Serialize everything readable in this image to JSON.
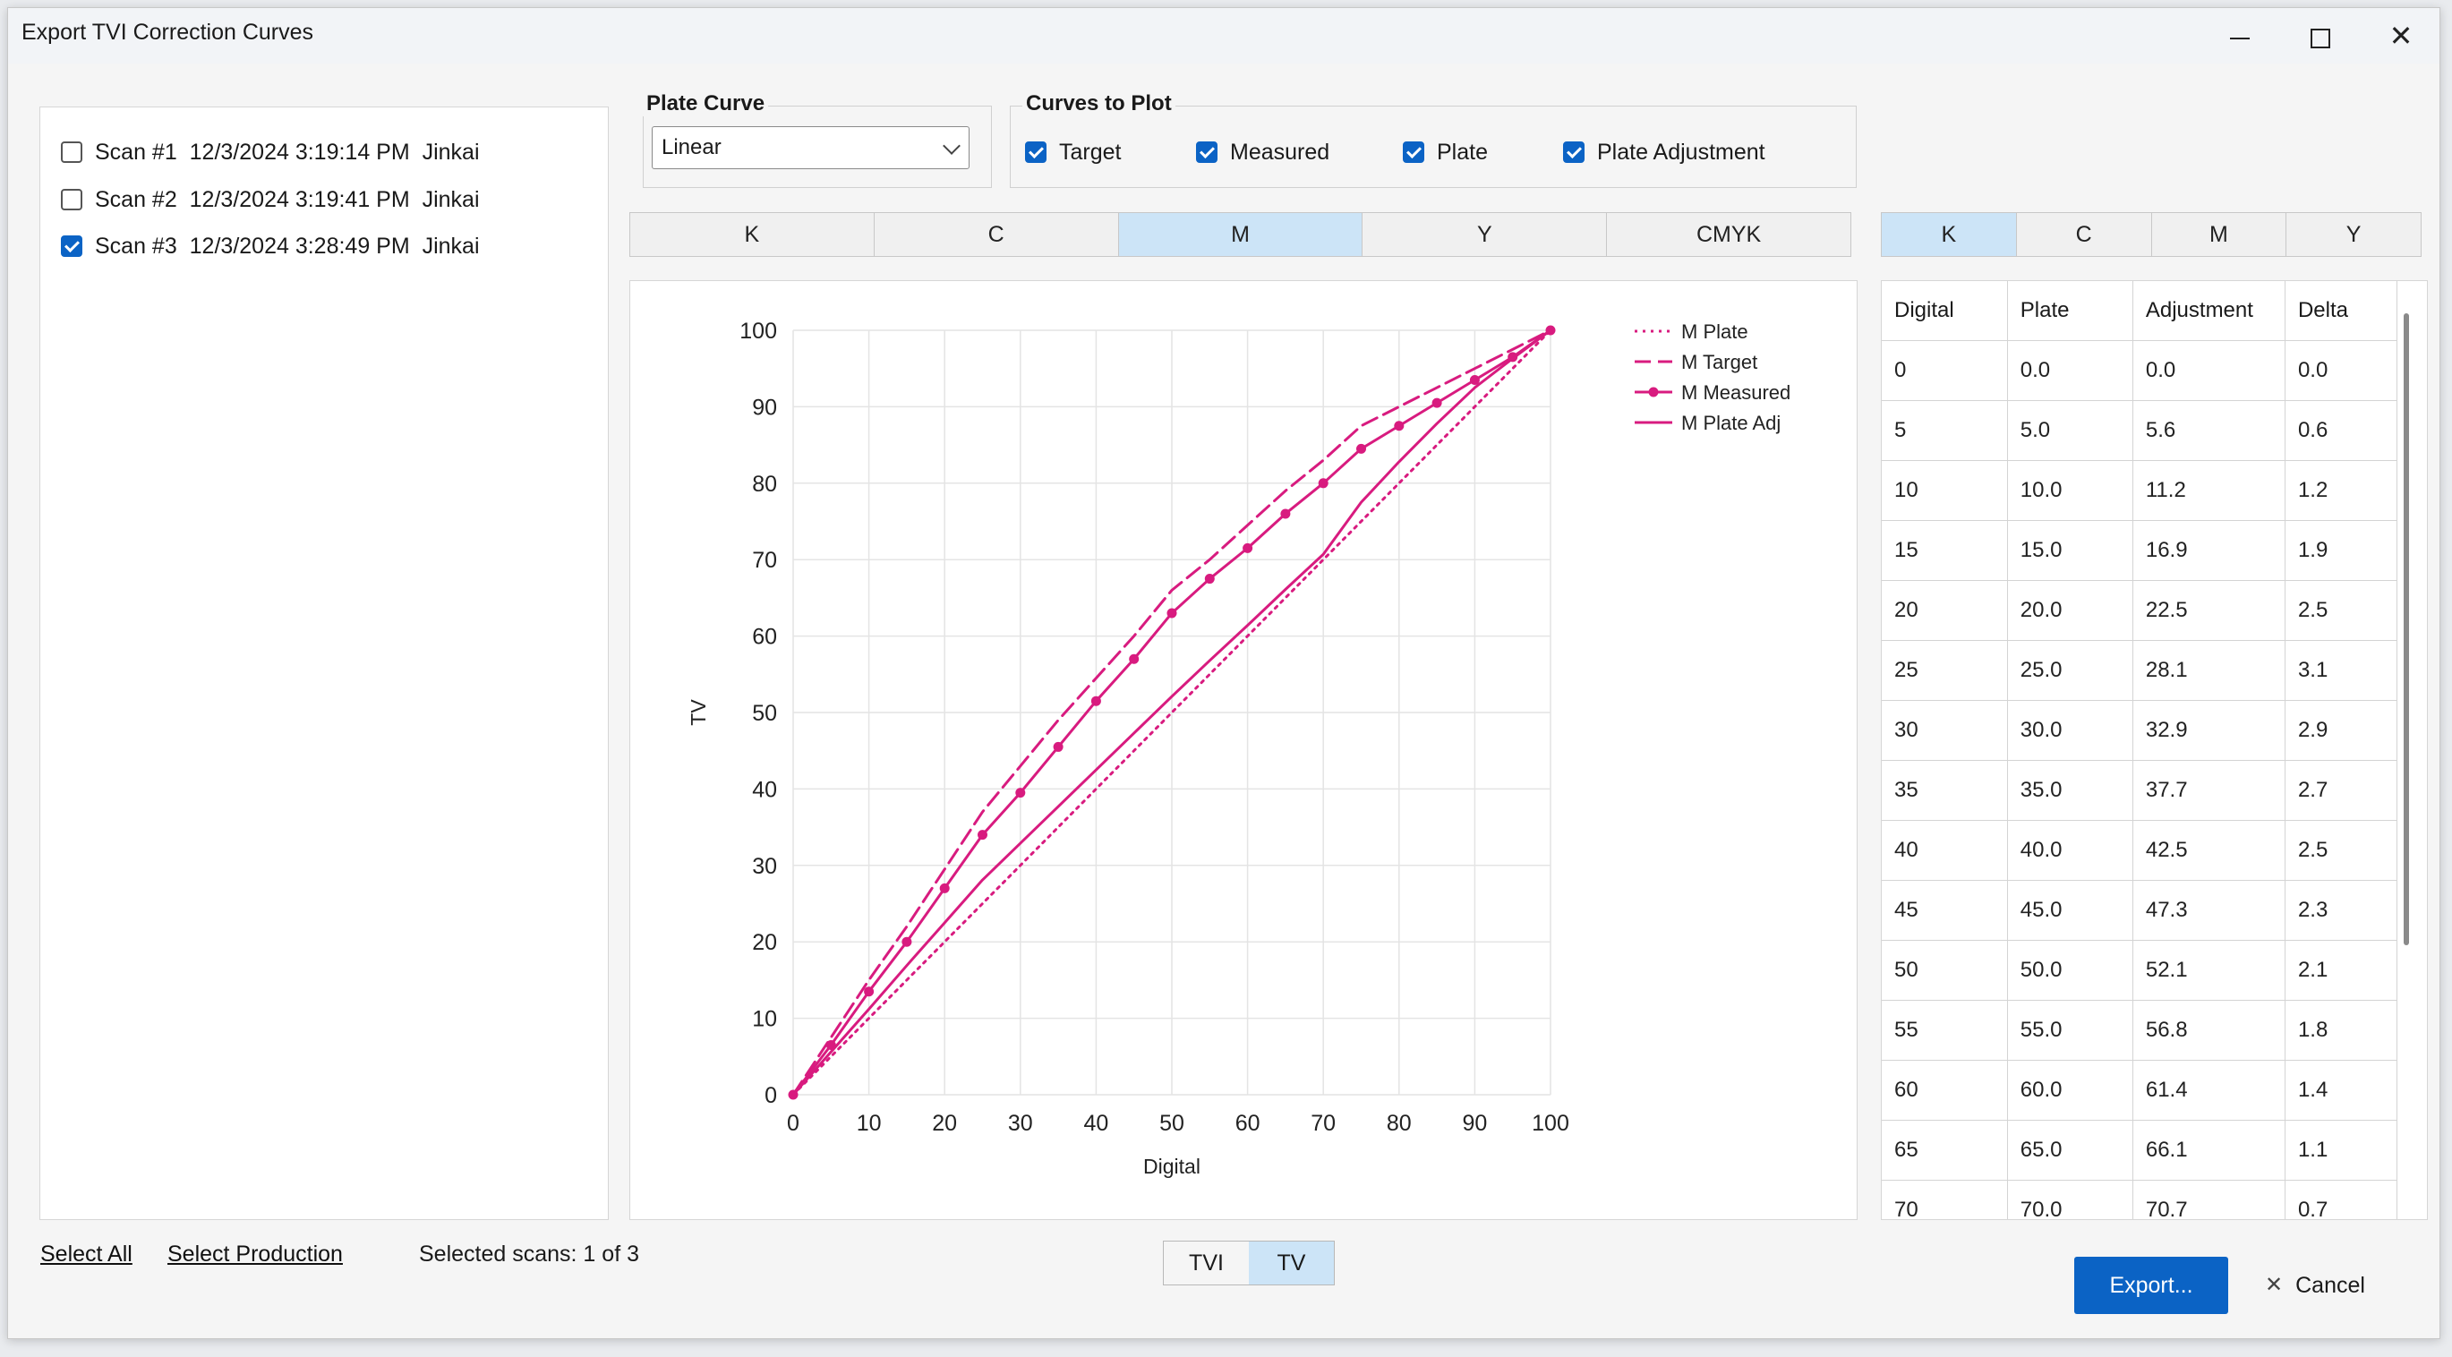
{
  "window": {
    "title": "Export TVI Correction Curves",
    "minimize_icon": "minimize-icon",
    "maximize_icon": "maximize-icon",
    "close_icon": "close-icon"
  },
  "scans": [
    {
      "label": "Scan #1",
      "date": "12/3/2024 3:19:14 PM",
      "user": "Jinkai",
      "checked": false
    },
    {
      "label": "Scan #2",
      "date": "12/3/2024 3:19:41 PM",
      "user": "Jinkai",
      "checked": false
    },
    {
      "label": "Scan #3",
      "date": "12/3/2024 3:28:49 PM",
      "user": "Jinkai",
      "checked": true
    }
  ],
  "plate_curve": {
    "label": "Plate Curve",
    "value": "Linear"
  },
  "curves_to_plot": {
    "label": "Curves to Plot",
    "items": [
      {
        "label": "Target",
        "checked": true
      },
      {
        "label": "Measured",
        "checked": true
      },
      {
        "label": "Plate",
        "checked": true
      },
      {
        "label": "Plate Adjustment",
        "checked": true
      }
    ]
  },
  "channel_tabs": [
    "K",
    "C",
    "M",
    "Y",
    "CMYK"
  ],
  "channel_selected": "M",
  "table_tabs": [
    "K",
    "C",
    "M",
    "Y"
  ],
  "table_selected": "K",
  "table": {
    "headers": [
      "Digital",
      "Plate",
      "Adjustment",
      "Delta"
    ],
    "rows": [
      [
        "0",
        "0.0",
        "0.0",
        "0.0"
      ],
      [
        "5",
        "5.0",
        "5.6",
        "0.6"
      ],
      [
        "10",
        "10.0",
        "11.2",
        "1.2"
      ],
      [
        "15",
        "15.0",
        "16.9",
        "1.9"
      ],
      [
        "20",
        "20.0",
        "22.5",
        "2.5"
      ],
      [
        "25",
        "25.0",
        "28.1",
        "3.1"
      ],
      [
        "30",
        "30.0",
        "32.9",
        "2.9"
      ],
      [
        "35",
        "35.0",
        "37.7",
        "2.7"
      ],
      [
        "40",
        "40.0",
        "42.5",
        "2.5"
      ],
      [
        "45",
        "45.0",
        "47.3",
        "2.3"
      ],
      [
        "50",
        "50.0",
        "52.1",
        "2.1"
      ],
      [
        "55",
        "55.0",
        "56.8",
        "1.8"
      ],
      [
        "60",
        "60.0",
        "61.4",
        "1.4"
      ],
      [
        "65",
        "65.0",
        "66.1",
        "1.1"
      ],
      [
        "70",
        "70.0",
        "70.7",
        "0.7"
      ]
    ]
  },
  "footer": {
    "select_all": "Select All",
    "select_production": "Select Production",
    "selected_scans": "Selected scans: 1 of 3",
    "mode_options": [
      "TVI",
      "TV"
    ],
    "mode_selected": "TV",
    "export_label": "Export...",
    "cancel_label": "Cancel"
  },
  "chart_data": {
    "type": "line",
    "xlabel": "Digital",
    "ylabel": "TV",
    "xlim": [
      0,
      100
    ],
    "ylim": [
      0,
      100
    ],
    "xticks": [
      0,
      10,
      20,
      30,
      40,
      50,
      60,
      70,
      80,
      90,
      100
    ],
    "yticks": [
      0,
      10,
      20,
      30,
      40,
      50,
      60,
      70,
      80,
      90,
      100
    ],
    "grid": true,
    "legend_position": "top-right",
    "color": "#d81b7f",
    "series": [
      {
        "name": "M Plate",
        "style": "dotted",
        "x": [
          0,
          100
        ],
        "y": [
          0,
          100
        ]
      },
      {
        "name": "M Target",
        "style": "dashed",
        "x": [
          0,
          5,
          10,
          15,
          20,
          25,
          30,
          35,
          40,
          45,
          50,
          55,
          60,
          65,
          70,
          75,
          80,
          85,
          90,
          95,
          100
        ],
        "y": [
          0,
          7.5,
          15,
          22,
          29.5,
          37,
          43,
          49,
          54.5,
          60,
          66,
          70,
          74.5,
          79,
          83,
          87.5,
          90,
          92.5,
          95,
          97.5,
          100
        ]
      },
      {
        "name": "M Measured",
        "style": "solid-markers",
        "x": [
          0,
          5,
          10,
          15,
          20,
          25,
          30,
          35,
          40,
          45,
          50,
          55,
          60,
          65,
          70,
          75,
          80,
          85,
          90,
          95,
          100
        ],
        "y": [
          0,
          6.5,
          13.5,
          20,
          27,
          34,
          39.5,
          45.5,
          51.5,
          57,
          63,
          67.5,
          71.5,
          76,
          80,
          84.5,
          87.5,
          90.5,
          93.5,
          96.5,
          100
        ]
      },
      {
        "name": "M Plate Adj",
        "style": "solid",
        "x": [
          0,
          5,
          10,
          15,
          20,
          25,
          30,
          35,
          40,
          45,
          50,
          55,
          60,
          65,
          70,
          75,
          80,
          85,
          90,
          95,
          100
        ],
        "y": [
          0,
          5.6,
          11.2,
          16.9,
          22.5,
          28.1,
          32.9,
          37.7,
          42.5,
          47.3,
          52.1,
          56.8,
          61.4,
          66.1,
          70.7,
          77.5,
          82.8,
          87.8,
          92.5,
          96.3,
          100
        ]
      }
    ]
  }
}
